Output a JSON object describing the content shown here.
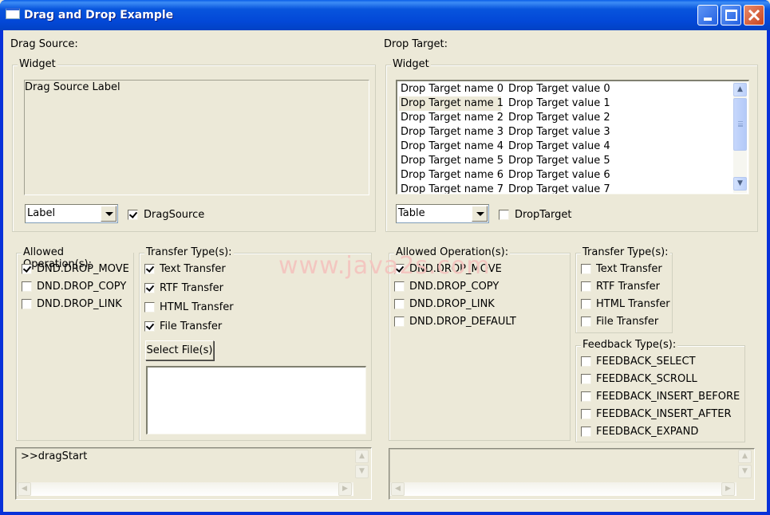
{
  "window": {
    "title": "Drag and Drop Example",
    "minimize_label": "_",
    "maximize_label": "□",
    "close_label": "✕"
  },
  "watermark": "www.java2s.com",
  "drag_source": {
    "heading": "Drag Source:",
    "widget_group_title": "Widget",
    "label_text": "Drag Source Label",
    "widget_type_combo": "Label",
    "enable_checkbox": {
      "label": "DragSource",
      "checked": true
    },
    "allowed_operations": {
      "title": "Allowed Operation(s):",
      "items": [
        {
          "label": "DND.DROP_MOVE",
          "checked": true
        },
        {
          "label": "DND.DROP_COPY",
          "checked": false
        },
        {
          "label": "DND.DROP_LINK",
          "checked": false
        }
      ]
    },
    "transfer_types": {
      "title": "Transfer Type(s):",
      "items": [
        {
          "label": "Text Transfer",
          "checked": true
        },
        {
          "label": "RTF Transfer",
          "checked": true
        },
        {
          "label": "HTML Transfer",
          "checked": false
        },
        {
          "label": "File Transfer",
          "checked": true
        }
      ],
      "select_files_button": "Select File(s)",
      "file_list_value": ""
    },
    "log_text": ">>dragStart"
  },
  "drop_target": {
    "heading": "Drop Target:",
    "widget_group_title": "Widget",
    "table_rows": [
      {
        "name": "Drop Target name 0",
        "value": "Drop Target value 0",
        "selected": false
      },
      {
        "name": "Drop Target name 1",
        "value": "Drop Target value 1",
        "selected": true
      },
      {
        "name": "Drop Target name 2",
        "value": "Drop Target value 2",
        "selected": false
      },
      {
        "name": "Drop Target name 3",
        "value": "Drop Target value 3",
        "selected": false
      },
      {
        "name": "Drop Target name 4",
        "value": "Drop Target value 4",
        "selected": false
      },
      {
        "name": "Drop Target name 5",
        "value": "Drop Target value 5",
        "selected": false
      },
      {
        "name": "Drop Target name 6",
        "value": "Drop Target value 6",
        "selected": false
      },
      {
        "name": "Drop Target name 7",
        "value": "Drop Target value 7",
        "selected": false
      }
    ],
    "widget_type_combo": "Table",
    "enable_checkbox": {
      "label": "DropTarget",
      "checked": false
    },
    "allowed_operations": {
      "title": "Allowed Operation(s):",
      "items": [
        {
          "label": "DND.DROP_MOVE",
          "checked": true
        },
        {
          "label": "DND.DROP_COPY",
          "checked": false
        },
        {
          "label": "DND.DROP_LINK",
          "checked": false
        },
        {
          "label": "DND.DROP_DEFAULT",
          "checked": false
        }
      ]
    },
    "transfer_types": {
      "title": "Transfer Type(s):",
      "items": [
        {
          "label": "Text Transfer",
          "checked": false
        },
        {
          "label": "RTF Transfer",
          "checked": false
        },
        {
          "label": "HTML Transfer",
          "checked": false
        },
        {
          "label": "File Transfer",
          "checked": false
        }
      ]
    },
    "feedback_types": {
      "title": "Feedback Type(s):",
      "items": [
        {
          "label": "FEEDBACK_SELECT",
          "checked": false
        },
        {
          "label": "FEEDBACK_SCROLL",
          "checked": false
        },
        {
          "label": "FEEDBACK_INSERT_BEFORE",
          "checked": false
        },
        {
          "label": "FEEDBACK_INSERT_AFTER",
          "checked": false
        },
        {
          "label": "FEEDBACK_EXPAND",
          "checked": false
        }
      ]
    },
    "log_text": ""
  },
  "scroll_glyphs": {
    "up": "▲",
    "down": "▼",
    "left": "◀",
    "right": "▶"
  }
}
